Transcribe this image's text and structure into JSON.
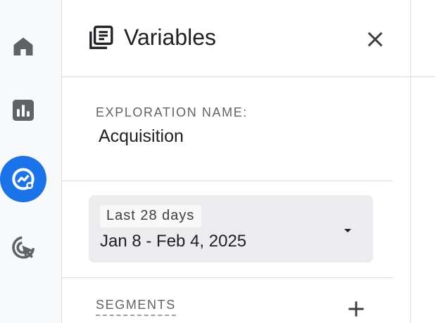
{
  "rail": {
    "items": [
      {
        "name": "home",
        "icon": "home-icon"
      },
      {
        "name": "reports",
        "icon": "bar-chart-icon"
      },
      {
        "name": "explore",
        "icon": "explore-icon",
        "active": true
      },
      {
        "name": "advertising",
        "icon": "target-cursor-icon"
      }
    ],
    "active_color": "#1a73e8",
    "icon_color": "#5f6368"
  },
  "panel": {
    "title": "Variables",
    "title_icon": "variables-icon",
    "close_icon": "close-icon",
    "exploration_name_label": "EXPLORATION NAME:",
    "exploration_name_value": "Acquisition",
    "date_preset": "Last 28 days",
    "date_range": "Jan 8 - Feb 4, 2025",
    "date_dropdown_icon": "caret-down-icon",
    "segments_label": "SEGMENTS",
    "segments_add_icon": "plus-icon"
  }
}
